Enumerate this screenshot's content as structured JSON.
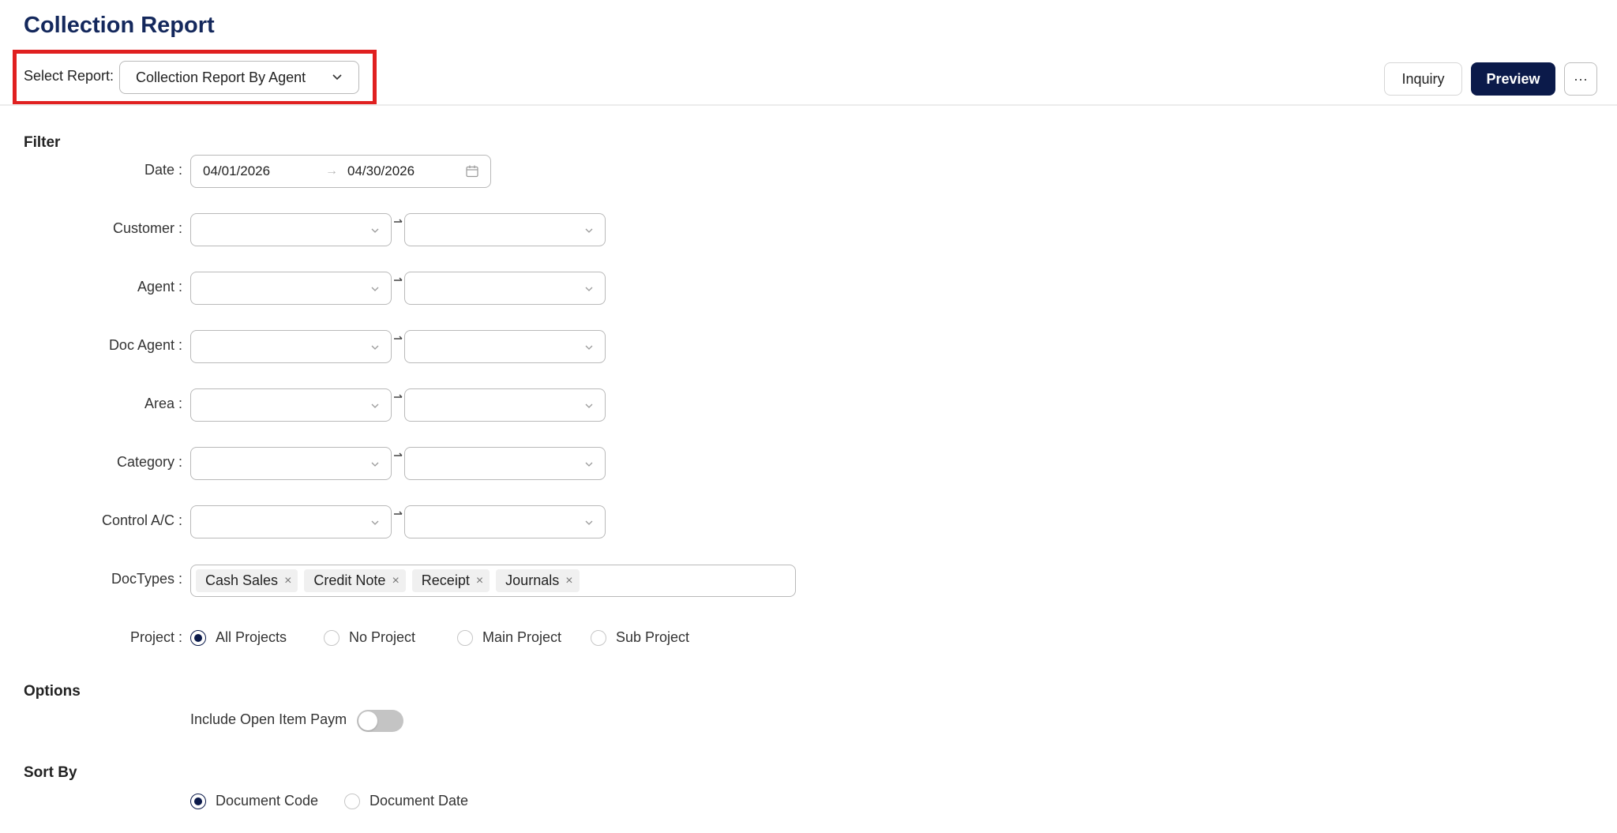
{
  "page": {
    "title": "Collection Report"
  },
  "report_selector": {
    "label": "Select Report:",
    "value": "Collection Report By Agent"
  },
  "toolbar": {
    "inquiry_label": "Inquiry",
    "preview_label": "Preview",
    "more_label": "···"
  },
  "filter": {
    "title": "Filter",
    "date": {
      "label": "Date :",
      "from": "04/01/2026",
      "arrow": "→",
      "to": "04/30/2026"
    },
    "ranges": [
      {
        "label": "Customer :"
      },
      {
        "label": "Agent :"
      },
      {
        "label": "Doc Agent :"
      },
      {
        "label": "Area :"
      },
      {
        "label": "Category :"
      },
      {
        "label": "Control A/C :"
      }
    ],
    "doctypes": {
      "label": "DocTypes :",
      "tags": [
        "Cash Sales",
        "Credit Note",
        "Receipt",
        "Journals"
      ],
      "remove_symbol": "×"
    },
    "project": {
      "label": "Project :",
      "options": [
        "All Projects",
        "No Project",
        "Main Project",
        "Sub Project"
      ],
      "selected": "All Projects"
    }
  },
  "options": {
    "title": "Options",
    "include_open_item_label": "Include Open Item Paym",
    "include_open_item_on": false
  },
  "sort_by": {
    "title": "Sort By",
    "options": [
      "Document Code",
      "Document Date"
    ],
    "selected": "Document Code"
  },
  "colors": {
    "title": "#14285c",
    "primary": "#0b1a4a",
    "highlight_box": "#e02020"
  }
}
